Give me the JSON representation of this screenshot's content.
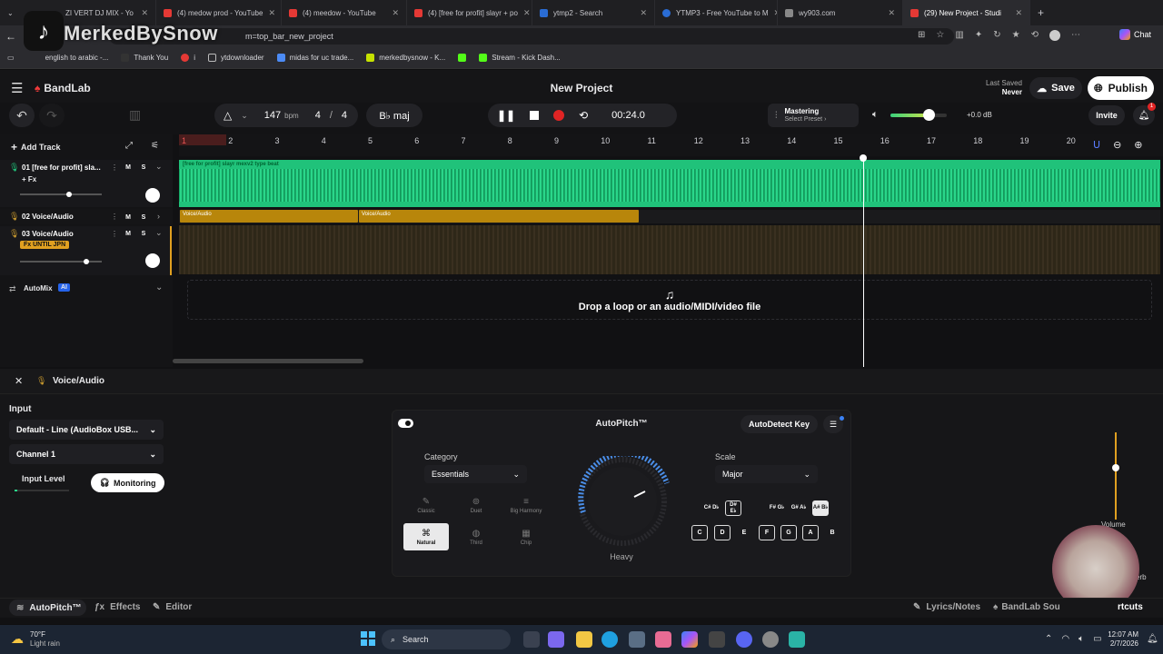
{
  "browser": {
    "tabs": [
      {
        "label": "ZI VERT DJ MIX - Yo"
      },
      {
        "label": "(4) medow prod - YouTube"
      },
      {
        "label": "(4) meedow - YouTube"
      },
      {
        "label": "(4) [free for profit] slayr + po"
      },
      {
        "label": "ytmp2 - Search"
      },
      {
        "label": "YTMP3 - Free YouTube to M"
      },
      {
        "label": "wy903.com"
      },
      {
        "label": "(29) New Project - Studi"
      }
    ],
    "url": "m=top_bar_new_project",
    "bookmarks": [
      "english to arabic -...",
      "Thank You",
      "i",
      "ytdownloader",
      "midas for uc trade...",
      "merkedbysnow - K...",
      "",
      "Stream - Kick Dash..."
    ],
    "chat_label": "Chat"
  },
  "overlay": {
    "name": "MerkedBySnow"
  },
  "app": {
    "brand": "BandLab",
    "project_title": "New Project",
    "last_saved_label": "Last Saved",
    "last_saved_value": "Never",
    "save": "Save",
    "publish": "Publish",
    "bpm": "147",
    "bpm_unit": "bpm",
    "time_sig_num": "4",
    "time_sig_den": "4",
    "key": "B♭ maj",
    "time": "00:24.0",
    "mastering": "Mastering",
    "mastering_sub": "Select Preset ›",
    "volume_db": "+0.0 dB",
    "invite": "Invite",
    "notif_count": "1",
    "add_track": "Add Track"
  },
  "ruler": [
    "1",
    "2",
    "3",
    "4",
    "5",
    "6",
    "7",
    "8",
    "9",
    "10",
    "11",
    "12",
    "13",
    "14",
    "15",
    "16",
    "17",
    "18",
    "19",
    "20"
  ],
  "tracks": [
    {
      "name": "01  [free for profit] sla...",
      "fx": "+ Fx",
      "m": "M",
      "s": "S",
      "clip": "[free for profit] slayr  mexv2 type beat"
    },
    {
      "name": "02  Voice/Audio",
      "m": "M",
      "s": "S",
      "clip_a": "Voice/Audio",
      "clip_b": "Voice/Audio"
    },
    {
      "name": "03  Voice/Audio",
      "fx": "Fx  UNTIL JPN",
      "m": "M",
      "s": "S"
    }
  ],
  "automix": {
    "label": "AutoMix",
    "badge": "AI"
  },
  "drop_text": "Drop a loop or an audio/MIDI/video file",
  "lower": {
    "track_name": "Voice/Audio",
    "input_label": "Input",
    "input_device": "Default - Line (AudioBox USB...",
    "channel": "Channel 1",
    "input_level": "Input Level",
    "monitoring": "Monitoring",
    "volume": "Volume",
    "reverb": "erb"
  },
  "autopitch": {
    "title": "AutoPitch™",
    "autodetect": "AutoDetect Key",
    "category_label": "Category",
    "category_value": "Essentials",
    "presets": [
      "Classic",
      "Duet",
      "Big Harmony",
      "Natural",
      "Third",
      "Chip"
    ],
    "knob_label": "Heavy",
    "scale_label": "Scale",
    "scale_value": "Major",
    "sharp_keys": [
      "C# D♭",
      "D# E♭",
      "F# G♭",
      "G# A♭",
      "A# B♭"
    ],
    "natural_keys": [
      "C",
      "D",
      "E",
      "F",
      "G",
      "A",
      "B"
    ]
  },
  "bottom": {
    "autopitch": "AutoPitch™",
    "effects": "Effects",
    "editor": "Editor",
    "lyrics": "Lyrics/Notes",
    "sounds": "BandLab Sou",
    "shortcuts": "rtcuts"
  },
  "taskbar": {
    "temp": "70°F",
    "weather": "Light rain",
    "search": "Search",
    "time": "12:07 AM",
    "date": "2/7/2026"
  }
}
